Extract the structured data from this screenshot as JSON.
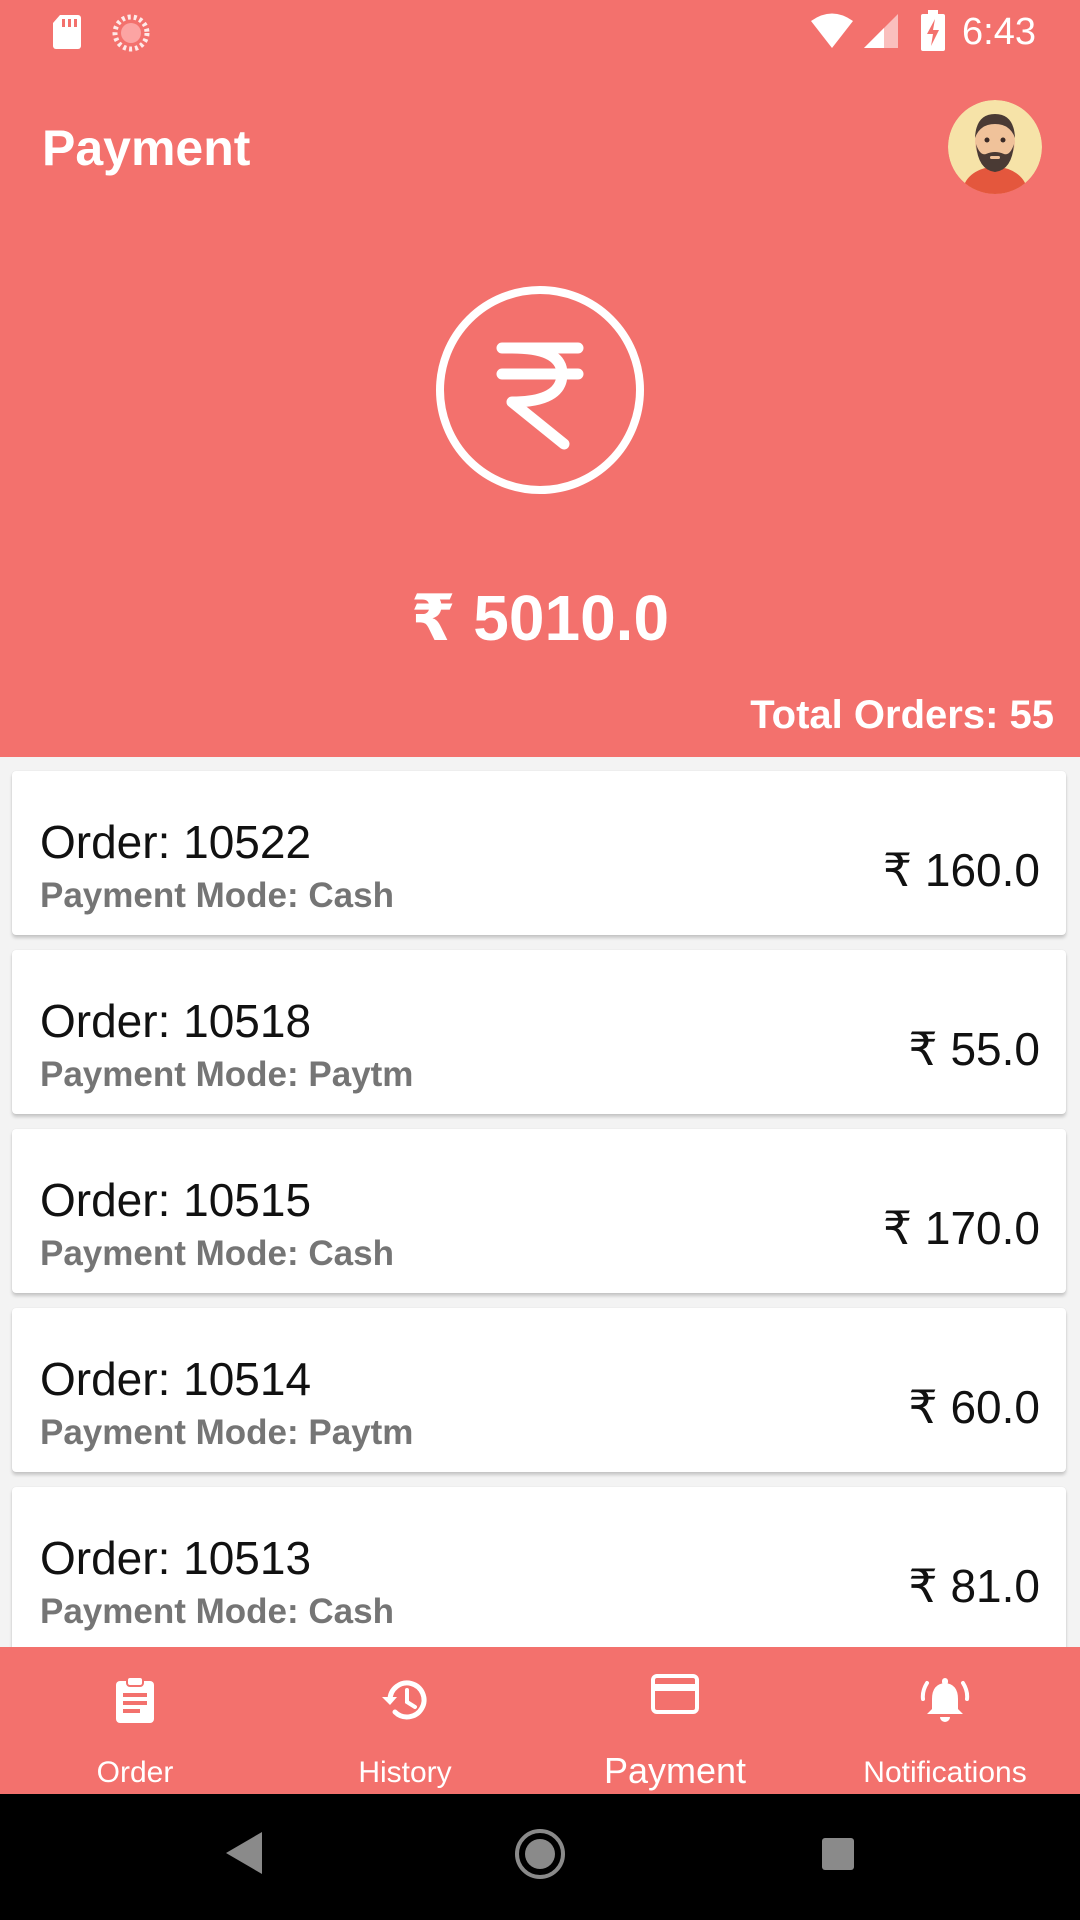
{
  "status_bar": {
    "time": "6:43"
  },
  "header": {
    "title": "Payment",
    "total_amount": "₹ 5010.0",
    "total_orders": "Total Orders: 55"
  },
  "colors": {
    "primary": "#f3716d",
    "card": "#ffffff",
    "muted_text": "#757575"
  },
  "orders": [
    {
      "id": "Order: 10522",
      "mode": "Payment Mode: Cash",
      "amount": "₹ 160.0"
    },
    {
      "id": "Order: 10518",
      "mode": "Payment Mode: Paytm",
      "amount": "₹ 55.0"
    },
    {
      "id": "Order: 10515",
      "mode": "Payment Mode: Cash",
      "amount": "₹ 170.0"
    },
    {
      "id": "Order: 10514",
      "mode": "Payment Mode: Paytm",
      "amount": "₹ 60.0"
    },
    {
      "id": "Order: 10513",
      "mode": "Payment Mode: Cash",
      "amount": "₹ 81.0"
    }
  ],
  "bottom_nav": {
    "items": [
      {
        "label": "Order",
        "icon": "clipboard-icon"
      },
      {
        "label": "History",
        "icon": "history-icon"
      },
      {
        "label": "Payment",
        "icon": "credit-card-icon",
        "active": true
      },
      {
        "label": "Notifications",
        "icon": "bell-icon"
      }
    ]
  }
}
